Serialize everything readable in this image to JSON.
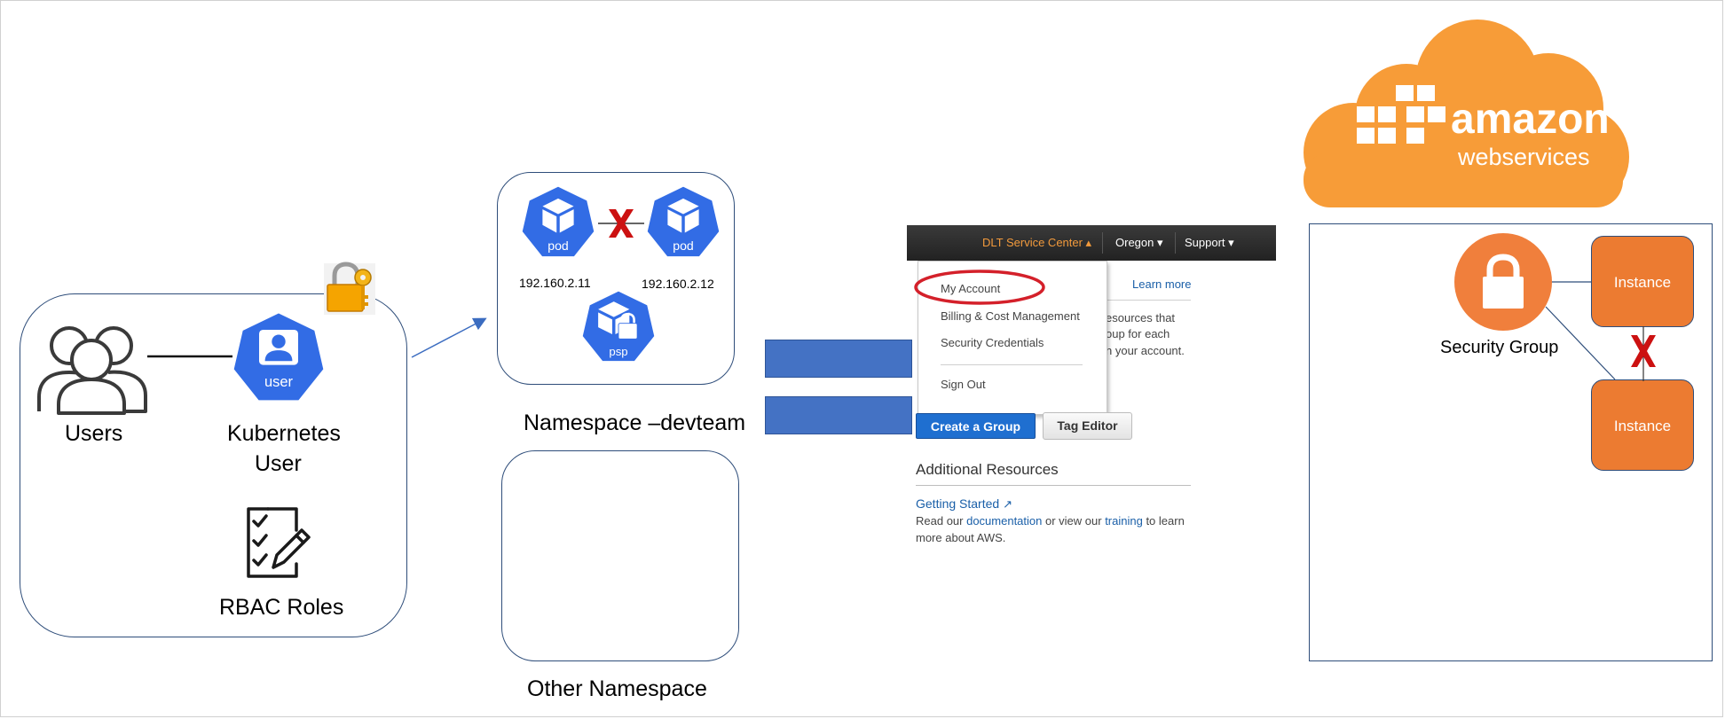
{
  "diagram": {
    "left_panel": {
      "users_label": "Users",
      "k8s_user_label_line1": "Kubernetes",
      "k8s_user_label_line2": "User",
      "user_icon_text": "user",
      "rbac_label": "RBAC Roles"
    },
    "namespace_panel": {
      "pod1_text": "pod",
      "pod2_text": "pod",
      "psp_text": "psp",
      "pod1_ip": "192.160.2.11",
      "pod2_ip": "192.160.2.12",
      "namespace_label": "Namespace –devteam",
      "other_namespace_label": "Other Namespace"
    },
    "aws_console": {
      "menu_service": "DLT Service Center ▴",
      "menu_region": "Oregon ▾",
      "menu_support": "Support ▾",
      "dropdown_items": [
        "My Account",
        "Billing & Cost Management",
        "Security Credentials",
        "Sign Out"
      ],
      "learn_more": "Learn more",
      "partial_text_1": "esources that",
      "partial_text_2": "oup for each",
      "partial_text_3": "n your account.",
      "create_group_button": "Create a Group",
      "tag_editor_button": "Tag Editor",
      "additional_resources_heading": "Additional Resources",
      "getting_started_link": "Getting Started",
      "desc_read_our": "Read our ",
      "desc_documentation": "documentation",
      "desc_or_view": " or view our ",
      "desc_training": "training",
      "desc_to_learn": " to learn",
      "desc_line2": "more about AWS."
    },
    "aws_panel": {
      "logo_word1": "amazon",
      "logo_word2": "webservices",
      "security_group_label": "Security Group",
      "instance1_label": "Instance",
      "instance2_label": "Instance"
    },
    "colors": {
      "k8s_blue": "#326ce5",
      "box_border": "#2e4d7a",
      "aws_orange": "#f79c38",
      "instance_orange": "#ec7b31",
      "security_group_orange": "#f07f3c",
      "deny_red": "#cc1111",
      "equals_blue": "#4472c4",
      "link_blue": "#1a5fa8"
    }
  }
}
